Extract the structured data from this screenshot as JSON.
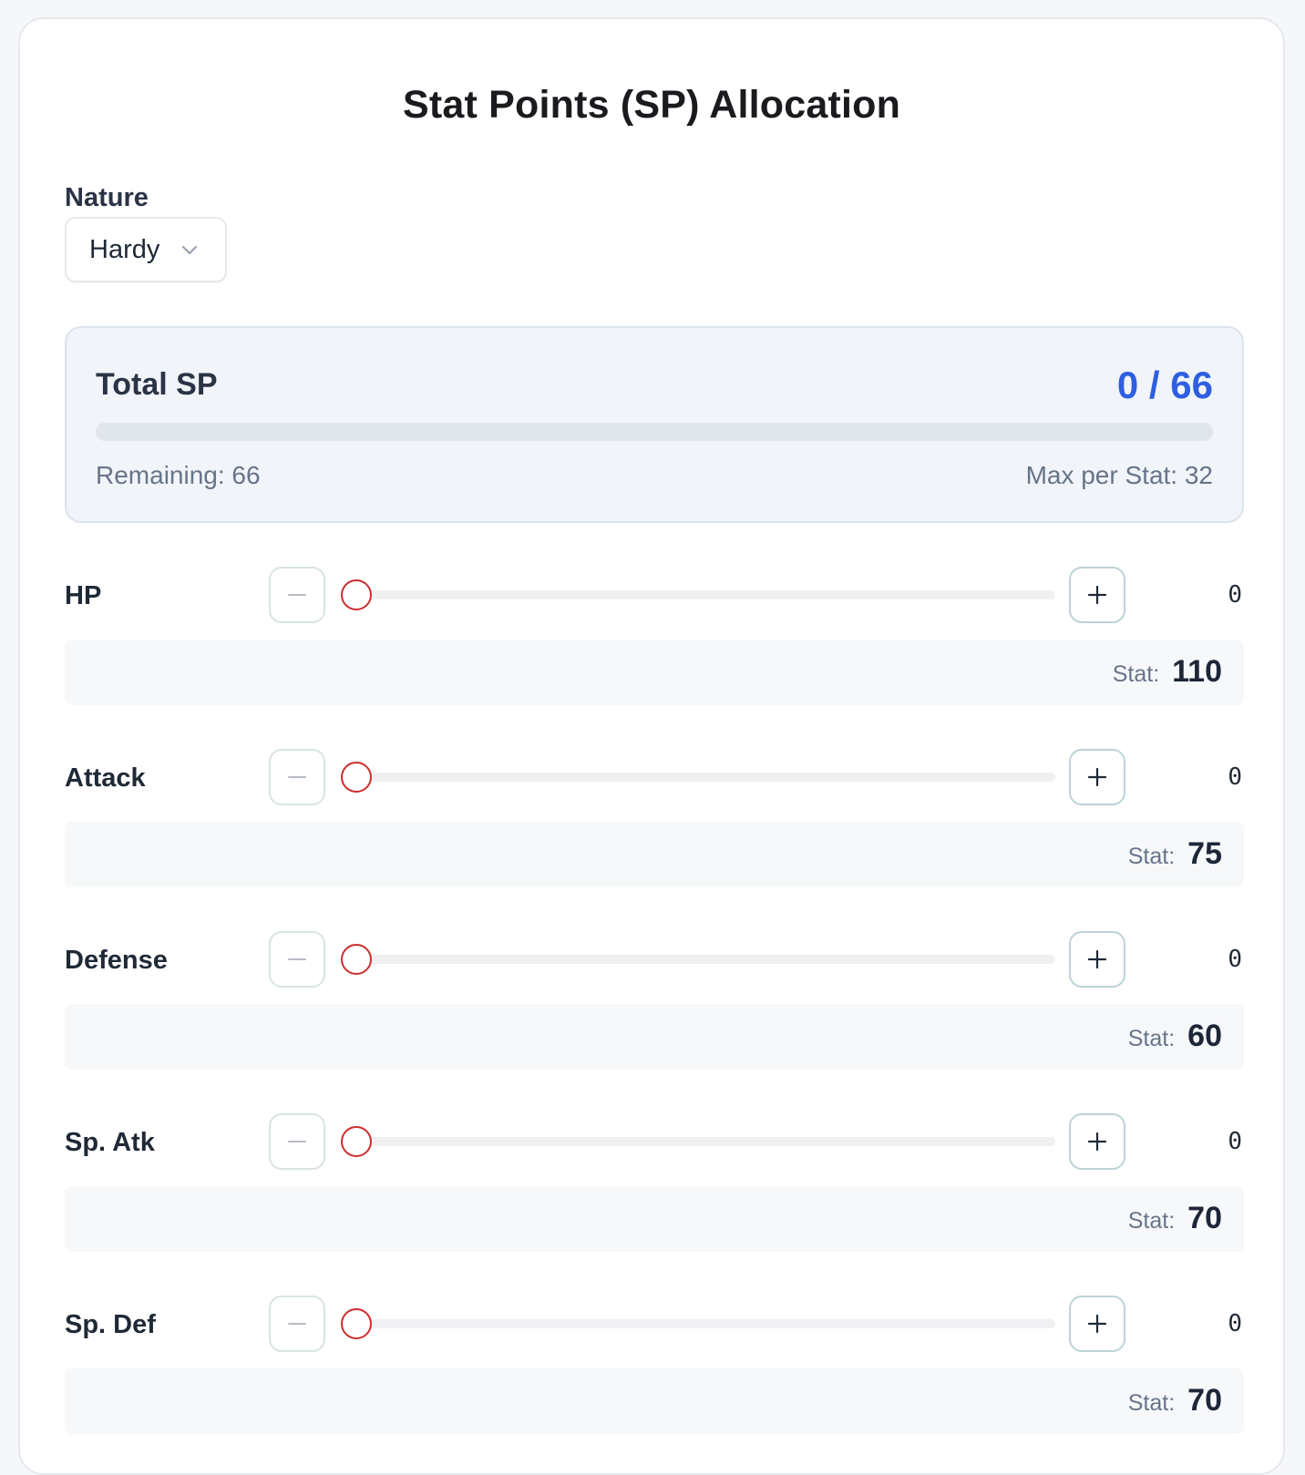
{
  "header": {
    "title": "Stat Points (SP) Allocation"
  },
  "nature": {
    "label": "Nature",
    "selected": "Hardy"
  },
  "summary": {
    "label": "Total SP",
    "total_display": "0 / 66",
    "allocated": 0,
    "max_total": 66,
    "progress_fraction": 0,
    "remaining_text": "Remaining: 66",
    "max_per_stat_text": "Max per Stat: 32",
    "accent_color": "#2f5fe0"
  },
  "stats": [
    {
      "name": "HP",
      "sp": "0",
      "sp_fraction": 0,
      "stat_label": "Stat:",
      "stat_value": "110"
    },
    {
      "name": "Attack",
      "sp": "0",
      "sp_fraction": 0,
      "stat_label": "Stat:",
      "stat_value": "75"
    },
    {
      "name": "Defense",
      "sp": "0",
      "sp_fraction": 0,
      "stat_label": "Stat:",
      "stat_value": "60"
    },
    {
      "name": "Sp. Atk",
      "sp": "0",
      "sp_fraction": 0,
      "stat_label": "Stat:",
      "stat_value": "70"
    },
    {
      "name": "Sp. Def",
      "sp": "0",
      "sp_fraction": 0,
      "stat_label": "Stat:",
      "stat_value": "70"
    }
  ],
  "icons": {
    "nature_dropdown": "chevron-down-icon",
    "decrement": "minus-icon",
    "increment": "plus-icon"
  },
  "colors": {
    "slider_thumb": "#cc2d2d"
  }
}
